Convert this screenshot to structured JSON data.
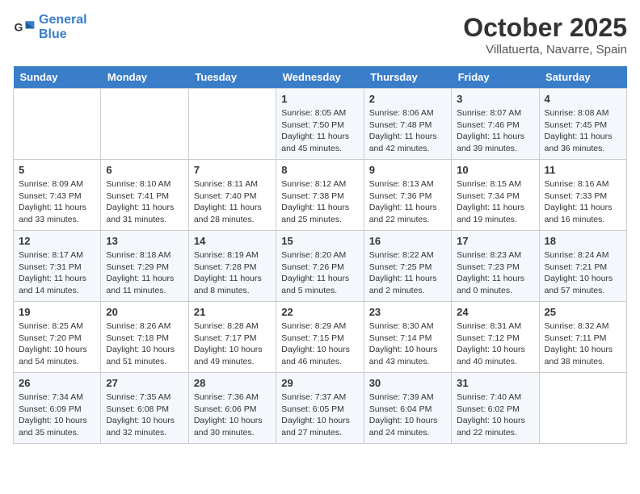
{
  "header": {
    "logo_line1": "General",
    "logo_line2": "Blue",
    "month": "October 2025",
    "location": "Villatuerta, Navarre, Spain"
  },
  "weekdays": [
    "Sunday",
    "Monday",
    "Tuesday",
    "Wednesday",
    "Thursday",
    "Friday",
    "Saturday"
  ],
  "weeks": [
    [
      {
        "day": "",
        "details": ""
      },
      {
        "day": "",
        "details": ""
      },
      {
        "day": "",
        "details": ""
      },
      {
        "day": "1",
        "details": "Sunrise: 8:05 AM\nSunset: 7:50 PM\nDaylight: 11 hours\nand 45 minutes."
      },
      {
        "day": "2",
        "details": "Sunrise: 8:06 AM\nSunset: 7:48 PM\nDaylight: 11 hours\nand 42 minutes."
      },
      {
        "day": "3",
        "details": "Sunrise: 8:07 AM\nSunset: 7:46 PM\nDaylight: 11 hours\nand 39 minutes."
      },
      {
        "day": "4",
        "details": "Sunrise: 8:08 AM\nSunset: 7:45 PM\nDaylight: 11 hours\nand 36 minutes."
      }
    ],
    [
      {
        "day": "5",
        "details": "Sunrise: 8:09 AM\nSunset: 7:43 PM\nDaylight: 11 hours\nand 33 minutes."
      },
      {
        "day": "6",
        "details": "Sunrise: 8:10 AM\nSunset: 7:41 PM\nDaylight: 11 hours\nand 31 minutes."
      },
      {
        "day": "7",
        "details": "Sunrise: 8:11 AM\nSunset: 7:40 PM\nDaylight: 11 hours\nand 28 minutes."
      },
      {
        "day": "8",
        "details": "Sunrise: 8:12 AM\nSunset: 7:38 PM\nDaylight: 11 hours\nand 25 minutes."
      },
      {
        "day": "9",
        "details": "Sunrise: 8:13 AM\nSunset: 7:36 PM\nDaylight: 11 hours\nand 22 minutes."
      },
      {
        "day": "10",
        "details": "Sunrise: 8:15 AM\nSunset: 7:34 PM\nDaylight: 11 hours\nand 19 minutes."
      },
      {
        "day": "11",
        "details": "Sunrise: 8:16 AM\nSunset: 7:33 PM\nDaylight: 11 hours\nand 16 minutes."
      }
    ],
    [
      {
        "day": "12",
        "details": "Sunrise: 8:17 AM\nSunset: 7:31 PM\nDaylight: 11 hours\nand 14 minutes."
      },
      {
        "day": "13",
        "details": "Sunrise: 8:18 AM\nSunset: 7:29 PM\nDaylight: 11 hours\nand 11 minutes."
      },
      {
        "day": "14",
        "details": "Sunrise: 8:19 AM\nSunset: 7:28 PM\nDaylight: 11 hours\nand 8 minutes."
      },
      {
        "day": "15",
        "details": "Sunrise: 8:20 AM\nSunset: 7:26 PM\nDaylight: 11 hours\nand 5 minutes."
      },
      {
        "day": "16",
        "details": "Sunrise: 8:22 AM\nSunset: 7:25 PM\nDaylight: 11 hours\nand 2 minutes."
      },
      {
        "day": "17",
        "details": "Sunrise: 8:23 AM\nSunset: 7:23 PM\nDaylight: 11 hours\nand 0 minutes."
      },
      {
        "day": "18",
        "details": "Sunrise: 8:24 AM\nSunset: 7:21 PM\nDaylight: 10 hours\nand 57 minutes."
      }
    ],
    [
      {
        "day": "19",
        "details": "Sunrise: 8:25 AM\nSunset: 7:20 PM\nDaylight: 10 hours\nand 54 minutes."
      },
      {
        "day": "20",
        "details": "Sunrise: 8:26 AM\nSunset: 7:18 PM\nDaylight: 10 hours\nand 51 minutes."
      },
      {
        "day": "21",
        "details": "Sunrise: 8:28 AM\nSunset: 7:17 PM\nDaylight: 10 hours\nand 49 minutes."
      },
      {
        "day": "22",
        "details": "Sunrise: 8:29 AM\nSunset: 7:15 PM\nDaylight: 10 hours\nand 46 minutes."
      },
      {
        "day": "23",
        "details": "Sunrise: 8:30 AM\nSunset: 7:14 PM\nDaylight: 10 hours\nand 43 minutes."
      },
      {
        "day": "24",
        "details": "Sunrise: 8:31 AM\nSunset: 7:12 PM\nDaylight: 10 hours\nand 40 minutes."
      },
      {
        "day": "25",
        "details": "Sunrise: 8:32 AM\nSunset: 7:11 PM\nDaylight: 10 hours\nand 38 minutes."
      }
    ],
    [
      {
        "day": "26",
        "details": "Sunrise: 7:34 AM\nSunset: 6:09 PM\nDaylight: 10 hours\nand 35 minutes."
      },
      {
        "day": "27",
        "details": "Sunrise: 7:35 AM\nSunset: 6:08 PM\nDaylight: 10 hours\nand 32 minutes."
      },
      {
        "day": "28",
        "details": "Sunrise: 7:36 AM\nSunset: 6:06 PM\nDaylight: 10 hours\nand 30 minutes."
      },
      {
        "day": "29",
        "details": "Sunrise: 7:37 AM\nSunset: 6:05 PM\nDaylight: 10 hours\nand 27 minutes."
      },
      {
        "day": "30",
        "details": "Sunrise: 7:39 AM\nSunset: 6:04 PM\nDaylight: 10 hours\nand 24 minutes."
      },
      {
        "day": "31",
        "details": "Sunrise: 7:40 AM\nSunset: 6:02 PM\nDaylight: 10 hours\nand 22 minutes."
      },
      {
        "day": "",
        "details": ""
      }
    ]
  ]
}
